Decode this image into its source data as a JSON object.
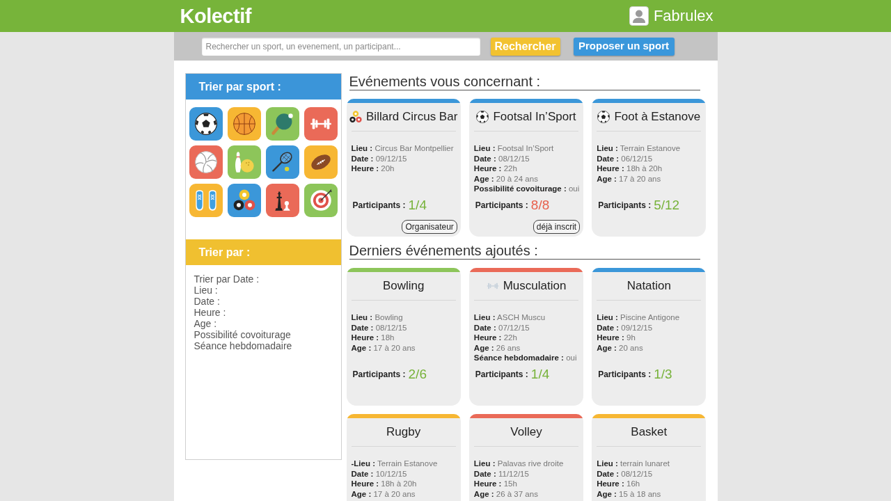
{
  "header": {
    "logo": "Kolectif",
    "user": "Fabrulex"
  },
  "search": {
    "placeholder": "Rechercher un sport, un evenement, un participant...",
    "search_button": "Rechercher",
    "propose_button": "Proposer un sport"
  },
  "sidebar": {
    "sport_filter": {
      "title": "Trier par sport :",
      "sports": [
        {
          "kind": "football",
          "color": "#3b97d9"
        },
        {
          "kind": "basketball",
          "color": "#f7b733"
        },
        {
          "kind": "ping-pong",
          "color": "#8dc55a"
        },
        {
          "kind": "musculation",
          "color": "#ea6a58"
        },
        {
          "kind": "volley",
          "color": "#ea6a58"
        },
        {
          "kind": "bowling",
          "color": "#8dc55a"
        },
        {
          "kind": "tennis",
          "color": "#3b97d9"
        },
        {
          "kind": "rugby",
          "color": "#f7b733"
        },
        {
          "kind": "running",
          "color": "#f7b733"
        },
        {
          "kind": "billard",
          "color": "#3b97d9"
        },
        {
          "kind": "echecs",
          "color": "#ea6a58"
        },
        {
          "kind": "tir-a-l-arc",
          "color": "#8dc55a"
        }
      ]
    },
    "sort_filter": {
      "title": "Trier par :",
      "items": [
        "Trier par Date :",
        "Lieu :",
        "Date :",
        "Heure :",
        "Age :",
        "Possibilité covoiturage",
        "Séance hebdomadaire"
      ]
    }
  },
  "sections": [
    {
      "title": "Evénements vous concernant :",
      "events": [
        {
          "title": "Billard Circus Bar",
          "kind": "billard",
          "color": "#3b97d9",
          "details": [
            {
              "label": "Lieu :",
              "value": "Circus Bar Montpellier"
            },
            {
              "label": "Date :",
              "value": "09/12/15"
            },
            {
              "label": "Heure :",
              "value": "20h"
            }
          ],
          "participants_label": "Participants :",
          "participants": "1/4",
          "full": false,
          "action": "Organisateur"
        },
        {
          "title": "Footsal In’Sport",
          "kind": "football",
          "color": "#3b97d9",
          "details": [
            {
              "label": "Lieu :",
              "value": "Footsal In’Sport"
            },
            {
              "label": "Date :",
              "value": "08/12/15"
            },
            {
              "label": "Heure :",
              "value": "22h"
            },
            {
              "label": "Age :",
              "value": "20 à 24 ans"
            },
            {
              "label": "Possibilité covoiturage :",
              "value": "oui"
            }
          ],
          "participants_label": "Participants :",
          "participants": "8/8",
          "full": true,
          "action": "déjà inscrit"
        },
        {
          "title": "Foot à Estanove",
          "kind": "football",
          "color": "#3b97d9",
          "details": [
            {
              "label": "Lieu :",
              "value": "Terrain Estanove"
            },
            {
              "label": "Date :",
              "value": "06/12/15"
            },
            {
              "label": "Heure :",
              "value": "18h à 20h"
            },
            {
              "label": "Age :",
              "value": "17 à 20 ans"
            }
          ],
          "participants_label": "Participants :",
          "participants": "5/12",
          "full": false
        }
      ]
    },
    {
      "title": "Derniers événements ajoutés :",
      "events": [
        {
          "title": "Bowling",
          "color": "#8dc55a",
          "details": [
            {
              "label": "Lieu :",
              "value": "Bowling"
            },
            {
              "label": "Date :",
              "value": "08/12/15"
            },
            {
              "label": "Heure :",
              "value": "18h"
            },
            {
              "label": "Age :",
              "value": "17 à 20 ans"
            }
          ],
          "participants_label": "Participants :",
          "participants": "2/6",
          "full": false
        },
        {
          "title": "Musculation",
          "kind": "musculation",
          "color": "#ea6a58",
          "details": [
            {
              "label": "Lieu :",
              "value": "ASCH Muscu"
            },
            {
              "label": "Date :",
              "value": "07/12/15"
            },
            {
              "label": "Heure :",
              "value": "22h"
            },
            {
              "label": "Age :",
              "value": "26 ans"
            },
            {
              "label": "Séance hebdomadaire :",
              "value": "oui"
            }
          ],
          "participants_label": "Participants :",
          "participants": "1/4",
          "full": false
        },
        {
          "title": "Natation",
          "color": "#3b97d9",
          "details": [
            {
              "label": "Lieu :",
              "value": "Piscine Antigone"
            },
            {
              "label": "Date :",
              "value": "09/12/15"
            },
            {
              "label": "Heure :",
              "value": "9h"
            },
            {
              "label": "Age :",
              "value": "20 ans"
            }
          ],
          "participants_label": "Participants :",
          "participants": "1/3",
          "full": false
        },
        {
          "title": "Rugby",
          "color": "#f7b733",
          "details": [
            {
              "label": "-Lieu :",
              "value": "Terrain Estanove"
            },
            {
              "label": "Date :",
              "value": "10/12/15"
            },
            {
              "label": "Heure :",
              "value": "18h à 20h"
            },
            {
              "label": "Age :",
              "value": "17 à 20 ans"
            }
          ]
        },
        {
          "title": "Volley",
          "color": "#ea6a58",
          "details": [
            {
              "label": "Lieu :",
              "value": "Palavas rive droite"
            },
            {
              "label": "Date :",
              "value": "11/12/15"
            },
            {
              "label": "Heure :",
              "value": "15h"
            },
            {
              "label": "Age :",
              "value": "26 à 37 ans"
            }
          ]
        },
        {
          "title": "Basket",
          "color": "#f7b733",
          "details": [
            {
              "label": "Lieu :",
              "value": "terrain lunaret"
            },
            {
              "label": "Date :",
              "value": "08/12/15"
            },
            {
              "label": "Heure :",
              "value": "16h"
            },
            {
              "label": "Age :",
              "value": "15 à 18 ans"
            }
          ]
        }
      ]
    }
  ]
}
